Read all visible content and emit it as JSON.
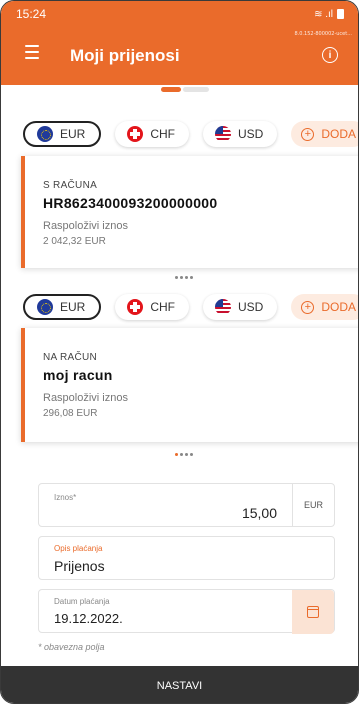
{
  "status": {
    "time": "15:24",
    "signal": "≋ .ıl"
  },
  "header": {
    "title": "Moji prijenosi",
    "subtitle": "8.0.152-800002-ucet..."
  },
  "currencies_from": {
    "eur": "EUR",
    "chf": "CHF",
    "usd": "USD",
    "add": "DODA"
  },
  "from_card": {
    "label": "S RAČUNA",
    "account": "HR8623400093200000000",
    "available_label": "Raspoloživi iznos",
    "amount": "2 042,32 EUR"
  },
  "currencies_to": {
    "eur": "EUR",
    "chf": "CHF",
    "usd": "USD",
    "add": "DODA"
  },
  "to_card": {
    "label": "NA RAČUN",
    "account": "moj racun",
    "available_label": "Raspoloživi iznos",
    "amount": "296,08 EUR"
  },
  "form": {
    "amount_label": "Iznos*",
    "amount_value": "15,00",
    "amount_currency": "EUR",
    "description_label": "Opis plaćanja",
    "description_value": "Prijenos",
    "date_label": "Datum plaćanja",
    "date_value": "19.12.2022.",
    "required_note": "* obavezna polja"
  },
  "footer": {
    "continue_label": "NASTAVI"
  },
  "colors": {
    "accent": "#ea6b2b",
    "footer": "#333333"
  }
}
